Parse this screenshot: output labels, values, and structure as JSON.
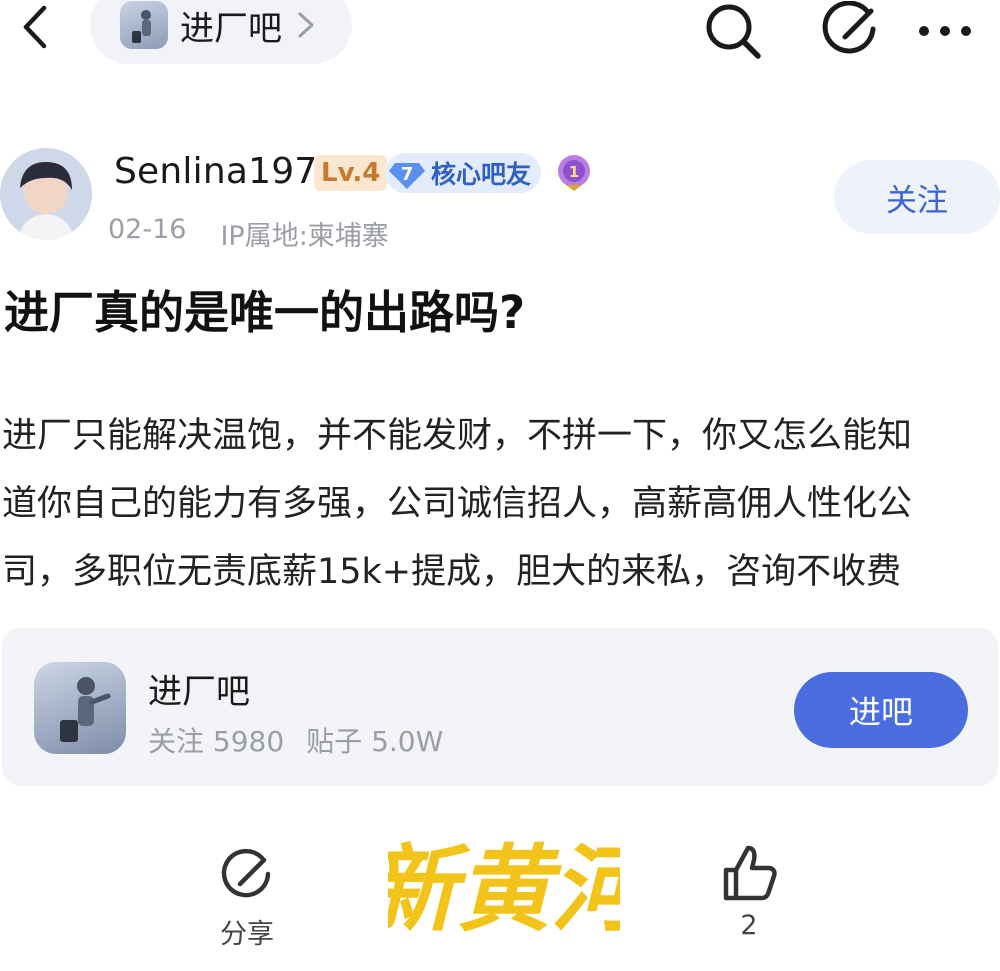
{
  "header": {
    "forum_name": "进厂吧",
    "icons": [
      "back-icon",
      "forum-avatar",
      "chevron-right-icon",
      "search-icon",
      "edit-icon",
      "more-icon"
    ]
  },
  "author": {
    "name": "Senlina197",
    "level": "Lv.4",
    "core_level": "7",
    "core_title": "核心吧友",
    "medal": "1",
    "date": "02-16",
    "ip_location": "IP属地:柬埔寨",
    "follow_label": "关注"
  },
  "post": {
    "title": "进厂真的是唯一的出路吗?",
    "lines": [
      "进厂只能解决温饱，并不能发财，不拼一下，你又怎么能知",
      "道你自己的能力有多强，公司诚信招人，高薪高佣人性化公",
      "司，多职位无责底薪15k+提成，胆大的来私，咨询不收费"
    ]
  },
  "forum_card": {
    "name": "进厂吧",
    "followers_label": "关注 5980",
    "posts_label": "贴子 5.0W",
    "enter_label": "进吧"
  },
  "bottom": {
    "share_label": "分享",
    "like_count": "2"
  },
  "watermark": {
    "text": "新黄河",
    "color": "#f2c318"
  },
  "colors": {
    "accent": "#4a6ee0",
    "follow_text": "#3b62d6",
    "meta": "#9b9ea6",
    "level_badge_bg": "#fbe6cf",
    "level_badge_text": "#c57a2e"
  }
}
